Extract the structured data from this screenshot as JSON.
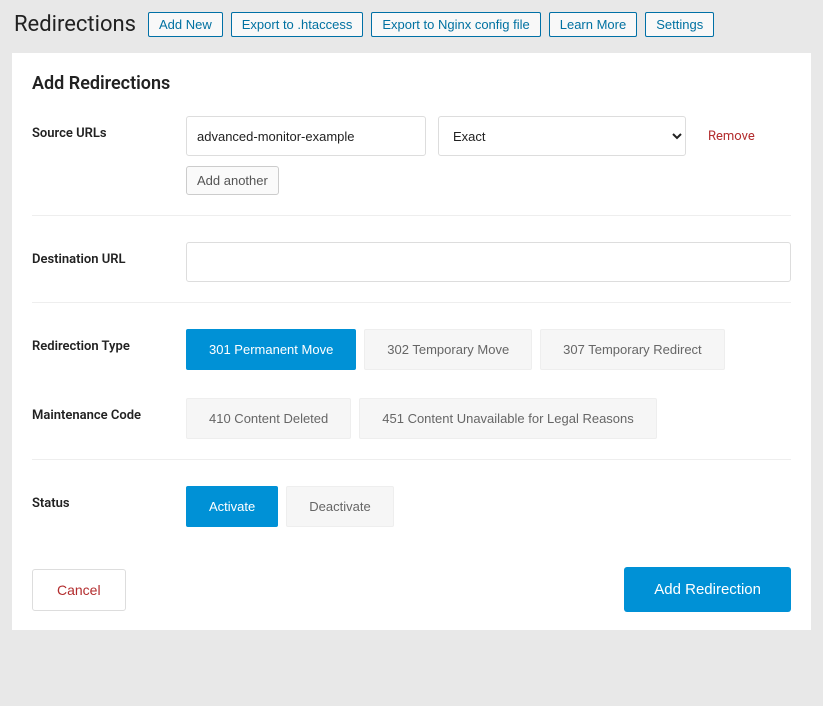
{
  "header": {
    "title": "Redirections",
    "nav": {
      "add_new": "Add New",
      "export_htaccess": "Export to .htaccess",
      "export_nginx": "Export to Nginx config file",
      "learn_more": "Learn More",
      "settings": "Settings"
    }
  },
  "panel": {
    "title": "Add Redirections",
    "labels": {
      "source_urls": "Source URLs",
      "destination_url": "Destination URL",
      "redirection_type": "Redirection Type",
      "maintenance_code": "Maintenance Code",
      "status": "Status"
    },
    "source": {
      "url_value": "advanced-monitor-example",
      "match_selected": "Exact",
      "remove": "Remove",
      "add_another": "Add another"
    },
    "destination": {
      "value": ""
    },
    "redirection_type": {
      "r301": "301 Permanent Move",
      "r302": "302 Temporary Move",
      "r307": "307 Temporary Redirect"
    },
    "maintenance_code": {
      "m410": "410 Content Deleted",
      "m451": "451 Content Unavailable for Legal Reasons"
    },
    "status": {
      "activate": "Activate",
      "deactivate": "Deactivate"
    },
    "footer": {
      "cancel": "Cancel",
      "submit": "Add Redirection"
    }
  }
}
